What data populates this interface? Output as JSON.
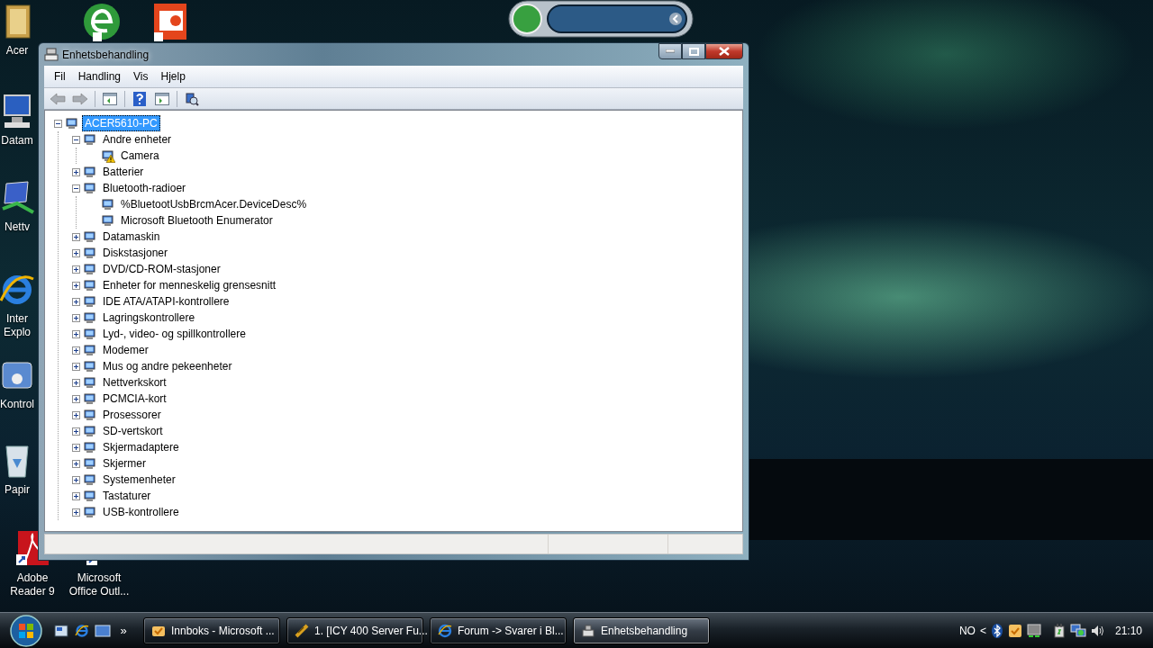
{
  "desktop_icons": [
    {
      "label": "Acer"
    },
    {
      "label": "Datam"
    },
    {
      "label": "Nettv"
    },
    {
      "label": "Inter Explo"
    },
    {
      "label": "Kontrol"
    },
    {
      "label": "Papir"
    },
    {
      "label": "Adobe Reader 9"
    },
    {
      "label": "Microsoft Office Outl..."
    }
  ],
  "window": {
    "title": "Enhetsbehandling"
  },
  "menu": [
    "Fil",
    "Handling",
    "Vis",
    "Hjelp"
  ],
  "nav_buttons": [
    {
      "disabled": true
    },
    {
      "disabled": true
    }
  ],
  "tree": [
    {
      "label": "ACER5610-PC",
      "selected": true,
      "expanded": true,
      "warning": false,
      "children": [
        {
          "label": "Andre enheter",
          "selected": false,
          "expanded": true,
          "warning": false,
          "children": [
            {
              "label": "Camera",
              "selected": false,
              "warning": true
            }
          ]
        },
        {
          "label": "Batterier",
          "selected": false,
          "expanded": false,
          "warning": false
        },
        {
          "label": "Bluetooth-radioer",
          "selected": false,
          "expanded": true,
          "warning": false,
          "children": [
            {
              "label": "%BluetootUsbBrcmAcer.DeviceDesc%",
              "selected": false,
              "warning": false
            },
            {
              "label": "Microsoft Bluetooth Enumerator",
              "selected": false,
              "warning": false
            }
          ]
        },
        {
          "label": "Datamaskin",
          "selected": false,
          "expanded": false,
          "warning": false
        },
        {
          "label": "Diskstasjoner",
          "selected": false,
          "expanded": false,
          "warning": false
        },
        {
          "label": "DVD/CD-ROM-stasjoner",
          "selected": false,
          "expanded": false,
          "warning": false
        },
        {
          "label": "Enheter for menneskelig grensesnitt",
          "selected": false,
          "expanded": false,
          "warning": false
        },
        {
          "label": "IDE ATA/ATAPI-kontrollere",
          "selected": false,
          "expanded": false,
          "warning": false
        },
        {
          "label": "Lagringskontrollere",
          "selected": false,
          "expanded": false,
          "warning": false
        },
        {
          "label": "Lyd-, video- og spillkontrollere",
          "selected": false,
          "expanded": false,
          "warning": false
        },
        {
          "label": "Modemer",
          "selected": false,
          "expanded": false,
          "warning": false
        },
        {
          "label": "Mus og andre pekeenheter",
          "selected": false,
          "expanded": false,
          "warning": false
        },
        {
          "label": "Nettverkskort",
          "selected": false,
          "expanded": false,
          "warning": false
        },
        {
          "label": "PCMCIA-kort",
          "selected": false,
          "expanded": false,
          "warning": false
        },
        {
          "label": "Prosessorer",
          "selected": false,
          "expanded": false,
          "warning": false
        },
        {
          "label": "SD-vertskort",
          "selected": false,
          "expanded": false,
          "warning": false
        },
        {
          "label": "Skjermadaptere",
          "selected": false,
          "expanded": false,
          "warning": false
        },
        {
          "label": "Skjermer",
          "selected": false,
          "expanded": false,
          "warning": false
        },
        {
          "label": "Systemenheter",
          "selected": false,
          "expanded": false,
          "warning": false
        },
        {
          "label": "Tastaturer",
          "selected": false,
          "expanded": false,
          "warning": false
        },
        {
          "label": "USB-kontrollere",
          "selected": false,
          "expanded": false,
          "warning": false
        }
      ]
    }
  ],
  "taskbar": {
    "quick_launch_more": "»",
    "tasks": [
      {
        "label": "Innboks - Microsoft ...",
        "selected": false
      },
      {
        "label": "1. [ICY 400 Server Fu...",
        "selected": false
      },
      {
        "label": "Forum -> Svarer i Bl...",
        "selected": false
      },
      {
        "label": "Enhetsbehandling",
        "selected": true
      }
    ],
    "language": "NO",
    "tray_chevron": "<",
    "clock": "21:10"
  }
}
